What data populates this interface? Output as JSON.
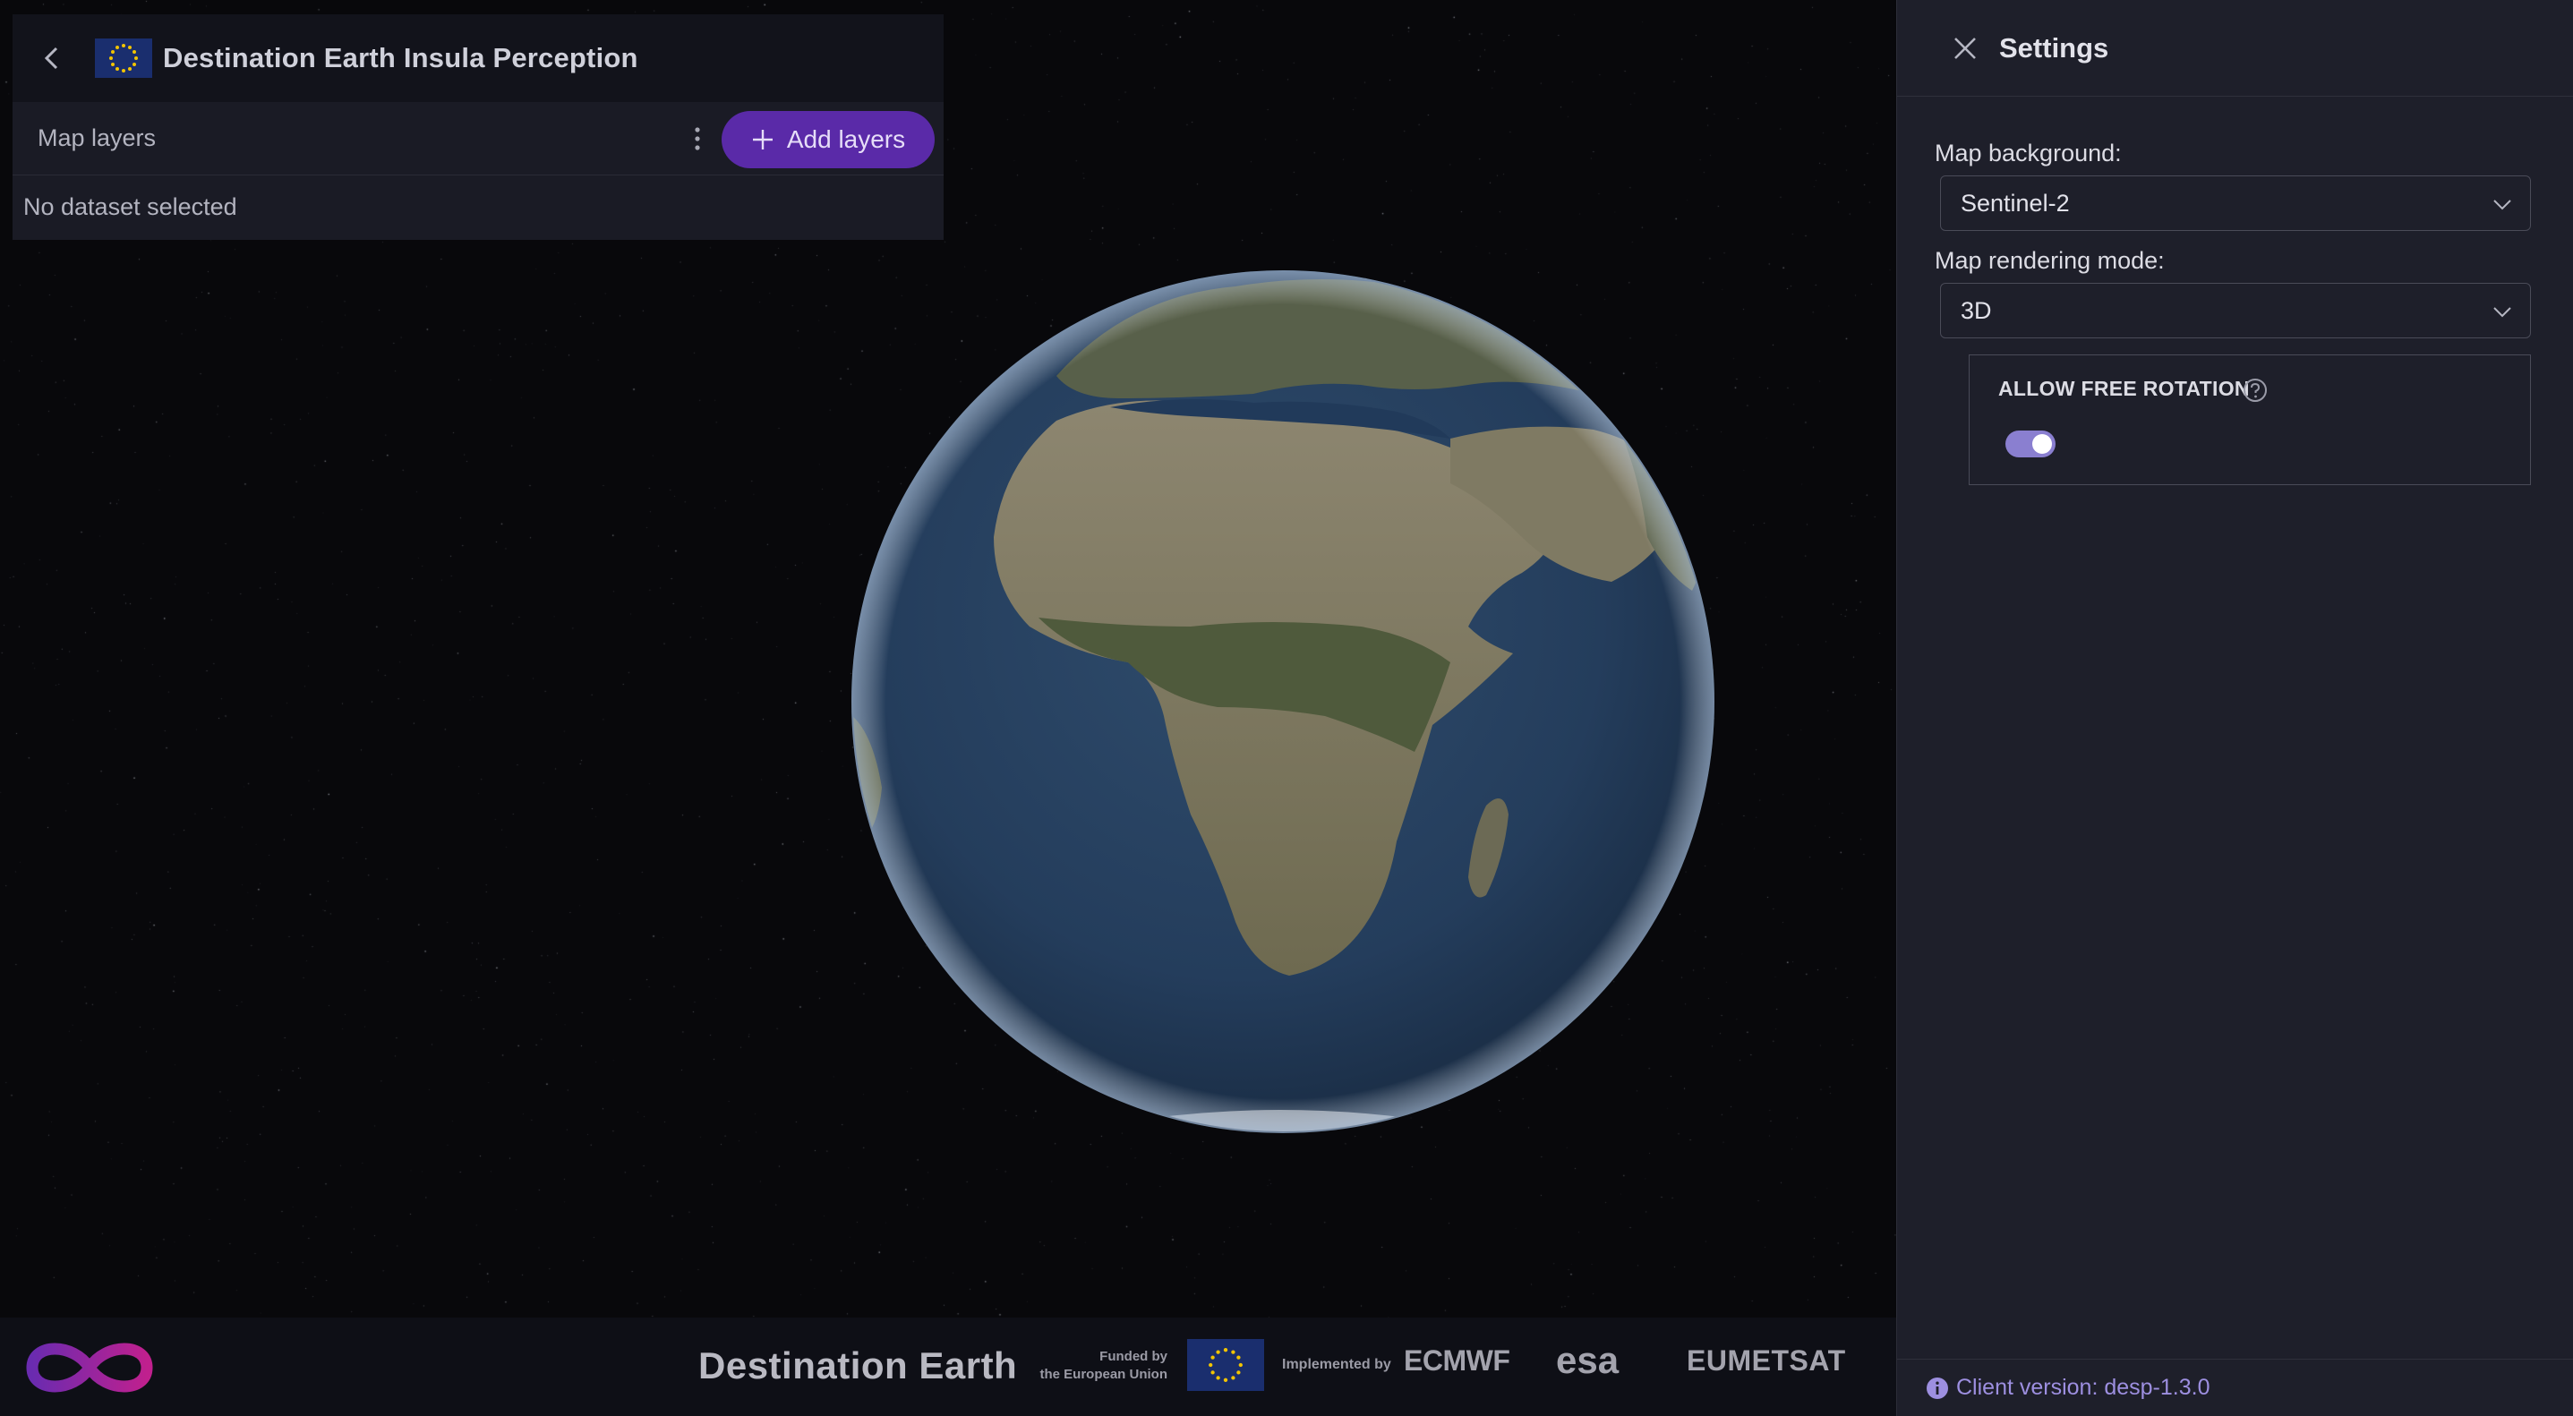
{
  "app": {
    "title": "Destination Earth Insula Perception"
  },
  "layers_panel": {
    "title": "Map layers",
    "add_button_label": "Add layers",
    "empty_message": "No dataset selected"
  },
  "settings": {
    "title": "Settings",
    "map_background": {
      "label": "Map background:",
      "value": "Sentinel-2"
    },
    "rendering_mode": {
      "label": "Map rendering mode:",
      "value": "3D"
    },
    "free_rotation": {
      "label": "ALLOW FREE ROTATION",
      "enabled": true
    },
    "client_version": "Client version: desp-1.3.0"
  },
  "footer": {
    "brand": "Destination Earth",
    "funded_by_line1": "Funded by",
    "funded_by_line2": "the European Union",
    "implemented_by": "Implemented by",
    "partner_1": "ECMWF",
    "partner_2": "esa",
    "partner_3": "EUMETSAT"
  },
  "colors": {
    "accent": "#5a2aa8",
    "toggle_on": "#8a7fd0",
    "link": "#9d8fe0",
    "panel_bg": "#1e1f2a"
  },
  "icons": {
    "back": "chevron-left-icon",
    "more": "vertical-dots-icon",
    "add": "plus-icon",
    "close": "close-icon",
    "dropdown": "chevron-down-icon",
    "help": "help-circle-icon",
    "info": "info-icon"
  }
}
